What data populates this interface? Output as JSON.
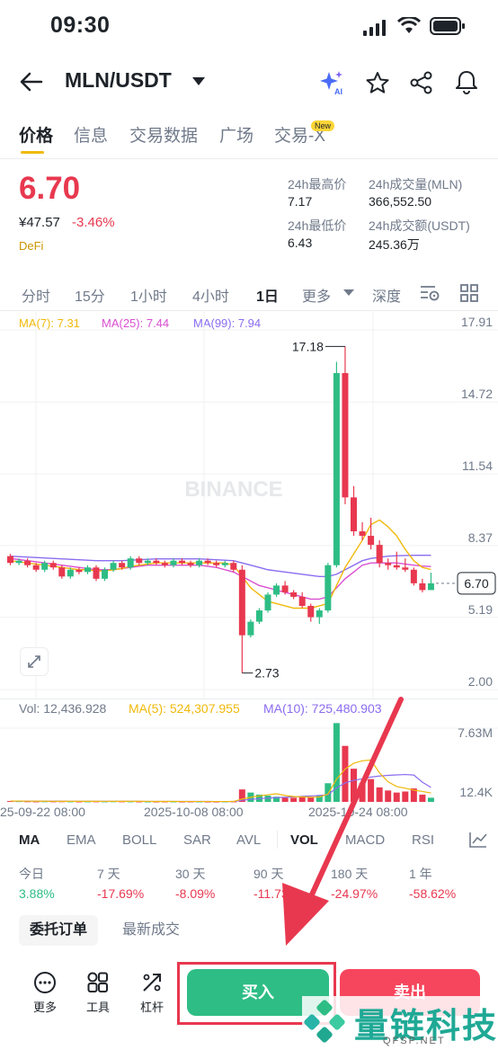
{
  "status_bar": {
    "time": "09:30"
  },
  "header": {
    "pair": "MLN/USDT"
  },
  "tabs": [
    {
      "label": "价格",
      "active": true
    },
    {
      "label": "信息"
    },
    {
      "label": "交易数据"
    },
    {
      "label": "广场"
    },
    {
      "label": "交易-X",
      "badge": "New"
    }
  ],
  "ticker": {
    "price": "6.70",
    "fiat": "¥47.57",
    "change": "-3.46%",
    "tag": "DeFi",
    "high_label": "24h最高价",
    "high": "7.17",
    "low_label": "24h最低价",
    "low": "6.43",
    "vol_base_label": "24h成交量(MLN)",
    "vol_base": "366,552.50",
    "vol_quote_label": "24h成交额(USDT)",
    "vol_quote": "245.36万"
  },
  "intervals": [
    "分时",
    "15分",
    "1小时",
    "4小时",
    "1日",
    "更多",
    "深度"
  ],
  "active_interval": "1日",
  "ma_line": {
    "ma7": "MA(7): 7.31",
    "ma25": "MA(25): 7.44",
    "ma99": "MA(99): 7.94"
  },
  "colors": {
    "up": "#2ebd85",
    "down": "#e8384f",
    "ma7": "#f0b90b",
    "ma25": "#d94fd1",
    "ma99": "#8b6cf0",
    "accent": "#fcd535"
  },
  "chart_data": {
    "type": "candlestick",
    "y_ticks": [
      "17.91",
      "14.72",
      "11.54",
      "8.37",
      "5.19",
      "2.00"
    ],
    "ylim": [
      2.0,
      17.91
    ],
    "current_price_label": "6.70",
    "max_label": "17.18",
    "min_label": "2.73",
    "x_labels": [
      "25-09-22 08:00",
      "2025-10-08 08:00",
      "2025-10-24 08:00"
    ],
    "candles": [
      [
        7.9,
        7.6,
        8.0,
        7.5
      ],
      [
        7.6,
        7.7,
        7.8,
        7.5
      ],
      [
        7.7,
        7.5,
        7.8,
        7.4
      ],
      [
        7.5,
        7.3,
        7.6,
        7.2
      ],
      [
        7.3,
        7.6,
        7.7,
        7.2
      ],
      [
        7.6,
        7.4,
        7.7,
        7.3
      ],
      [
        7.4,
        7.0,
        7.5,
        6.9
      ],
      [
        7.0,
        7.3,
        7.4,
        6.9
      ],
      [
        7.3,
        7.2,
        7.4,
        7.1
      ],
      [
        7.2,
        7.4,
        7.5,
        7.1
      ],
      [
        7.4,
        6.9,
        7.5,
        6.8
      ],
      [
        6.9,
        7.3,
        7.4,
        6.8
      ],
      [
        7.3,
        7.6,
        7.7,
        7.2
      ],
      [
        7.6,
        7.4,
        7.7,
        7.3
      ],
      [
        7.4,
        7.8,
        7.9,
        7.3
      ],
      [
        7.8,
        7.6,
        7.9,
        7.5
      ],
      [
        7.6,
        7.7,
        7.8,
        7.5
      ],
      [
        7.7,
        7.6,
        7.8,
        7.5
      ],
      [
        7.6,
        7.5,
        7.7,
        7.4
      ],
      [
        7.5,
        7.7,
        7.8,
        7.4
      ],
      [
        7.7,
        7.6,
        7.8,
        7.5
      ],
      [
        7.6,
        7.5,
        7.7,
        7.4
      ],
      [
        7.5,
        7.7,
        7.8,
        7.4
      ],
      [
        7.7,
        7.6,
        7.8,
        7.5
      ],
      [
        7.6,
        7.5,
        7.7,
        7.4
      ],
      [
        7.5,
        7.6,
        7.7,
        7.4
      ],
      [
        7.6,
        7.3,
        7.7,
        7.2
      ],
      [
        7.3,
        4.4,
        7.5,
        2.73
      ],
      [
        4.4,
        5.0,
        5.1,
        4.3
      ],
      [
        5.0,
        5.5,
        5.6,
        4.9
      ],
      [
        5.5,
        6.2,
        6.3,
        5.4
      ],
      [
        6.2,
        6.6,
        6.7,
        6.1
      ],
      [
        6.6,
        6.3,
        6.8,
        6.2
      ],
      [
        6.3,
        6.1,
        6.4,
        6.0
      ],
      [
        6.1,
        5.7,
        6.3,
        5.6
      ],
      [
        5.7,
        5.2,
        5.8,
        5.0
      ],
      [
        5.2,
        5.5,
        5.6,
        4.9
      ],
      [
        5.5,
        7.5,
        7.6,
        5.4
      ],
      [
        7.5,
        16.0,
        16.5,
        7.4
      ],
      [
        16.0,
        10.5,
        17.18,
        10.2
      ],
      [
        10.5,
        9.0,
        11.0,
        8.8
      ],
      [
        9.0,
        8.8,
        9.4,
        8.6
      ],
      [
        8.8,
        8.4,
        9.6,
        8.2
      ],
      [
        8.4,
        7.6,
        8.6,
        7.4
      ],
      [
        7.6,
        7.5,
        7.8,
        7.3
      ],
      [
        7.5,
        7.4,
        8.1,
        7.3
      ],
      [
        7.4,
        7.3,
        7.8,
        7.2
      ],
      [
        7.3,
        6.7,
        7.4,
        6.6
      ],
      [
        6.7,
        6.4,
        6.9,
        6.3
      ],
      [
        6.4,
        6.7,
        7.17,
        6.43
      ]
    ],
    "ma7": [
      7.7,
      7.65,
      7.6,
      7.55,
      7.5,
      7.45,
      7.4,
      7.35,
      7.3,
      7.3,
      7.25,
      7.25,
      7.3,
      7.35,
      7.45,
      7.5,
      7.55,
      7.6,
      7.6,
      7.6,
      7.6,
      7.6,
      7.6,
      7.6,
      7.6,
      7.6,
      7.5,
      7.0,
      6.5,
      6.2,
      5.9,
      5.8,
      5.7,
      5.6,
      5.6,
      5.6,
      5.7,
      5.8,
      6.6,
      7.4,
      8.0,
      8.6,
      9.3,
      9.5,
      9.2,
      8.8,
      8.2,
      7.7,
      7.4,
      7.31
    ],
    "ma25": [
      7.8,
      7.75,
      7.7,
      7.65,
      7.6,
      7.55,
      7.5,
      7.45,
      7.4,
      7.35,
      7.3,
      7.3,
      7.3,
      7.35,
      7.4,
      7.45,
      7.5,
      7.5,
      7.5,
      7.5,
      7.5,
      7.5,
      7.5,
      7.45,
      7.4,
      7.3,
      7.2,
      7.0,
      6.8,
      6.6,
      6.5,
      6.4,
      6.3,
      6.2,
      6.1,
      6.0,
      6.0,
      6.1,
      6.5,
      6.9,
      7.2,
      7.5,
      7.6,
      7.6,
      7.6,
      7.6,
      7.55,
      7.5,
      7.46,
      7.44
    ],
    "ma99": [
      7.9,
      7.88,
      7.86,
      7.84,
      7.82,
      7.8,
      7.78,
      7.76,
      7.74,
      7.72,
      7.7,
      7.7,
      7.7,
      7.7,
      7.72,
      7.74,
      7.76,
      7.78,
      7.78,
      7.78,
      7.78,
      7.78,
      7.78,
      7.76,
      7.74,
      7.72,
      7.7,
      7.6,
      7.5,
      7.4,
      7.3,
      7.25,
      7.2,
      7.15,
      7.1,
      7.05,
      7.0,
      7.0,
      7.1,
      7.3,
      7.5,
      7.7,
      7.8,
      7.85,
      7.9,
      7.92,
      7.93,
      7.94,
      7.94,
      7.94
    ],
    "volume": {
      "label": "Vol: 12,436.928",
      "ma5": "MA(5): 524,307.955",
      "ma10": "MA(10): 725,480.903",
      "y_ticks": [
        "7.63M",
        "12.4K"
      ],
      "ylim": [
        0,
        7630000
      ],
      "values": [
        80000,
        70000,
        60000,
        50000,
        60000,
        55000,
        60000,
        50000,
        45000,
        50000,
        55000,
        50000,
        60000,
        55000,
        50000,
        45000,
        40000,
        40000,
        45000,
        40000,
        35000,
        40000,
        40000,
        35000,
        35000,
        45000,
        50000,
        1200000,
        900000,
        700000,
        600000,
        500000,
        400000,
        400000,
        500000,
        450000,
        600000,
        1800000,
        7600000,
        5400000,
        3200000,
        1800000,
        2200000,
        1400000,
        1100000,
        900000,
        1000000,
        1300000,
        700000,
        400000
      ]
    }
  },
  "indicators": [
    "MA",
    "EMA",
    "BOLL",
    "SAR",
    "AVL",
    "VOL",
    "MACD",
    "RSI"
  ],
  "performance": [
    {
      "label": "今日",
      "value": "3.88%",
      "up": true
    },
    {
      "label": "7 天",
      "value": "-17.69%"
    },
    {
      "label": "30 天",
      "value": "-8.09%"
    },
    {
      "label": "90 天",
      "value": "-11.73%"
    },
    {
      "label": "180 天",
      "value": "-24.97%"
    },
    {
      "label": "1 年",
      "value": "-58.62%"
    }
  ],
  "subtabs": [
    "委托订单",
    "最新成交"
  ],
  "tools": [
    "更多",
    "工具",
    "杠杆"
  ],
  "actions": {
    "buy": "买入",
    "sell": "卖出"
  },
  "watermark": {
    "chart": "BINANCE",
    "brand": "量链科技",
    "url": "QFSP.NET"
  }
}
